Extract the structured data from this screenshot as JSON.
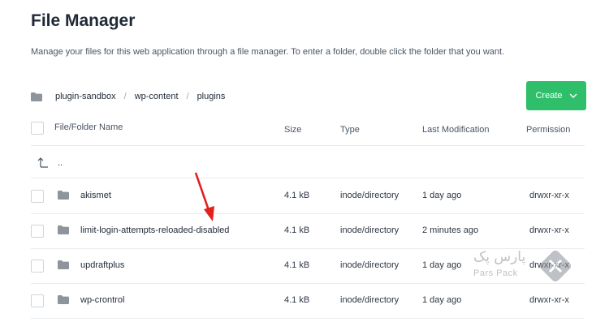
{
  "page": {
    "title": "File Manager",
    "description": "Manage your files for this web application through a file manager. To enter a folder, double click the folder that you want."
  },
  "breadcrumb": {
    "items": [
      "plugin-sandbox",
      "wp-content",
      "plugins"
    ],
    "separator": "/"
  },
  "create_button": {
    "label": "Create",
    "icon": "chevron-down-icon",
    "color": "#2fbf6a"
  },
  "table": {
    "headers": {
      "name": "File/Folder Name",
      "size": "Size",
      "type": "Type",
      "modified": "Last Modification",
      "permission": "Permission"
    },
    "parent_row": {
      "label": "..",
      "icon": "level-up-icon"
    },
    "rows": [
      {
        "name": "akismet",
        "size": "4.1 kB",
        "type": "inode/directory",
        "modified": "1 day ago",
        "permission": "drwxr-xr-x"
      },
      {
        "name": "limit-login-attempts-reloaded-disabled",
        "size": "4.1 kB",
        "type": "inode/directory",
        "modified": "2 minutes ago",
        "permission": "drwxr-xr-x"
      },
      {
        "name": "updraftplus",
        "size": "4.1 kB",
        "type": "inode/directory",
        "modified": "1 day ago",
        "permission": "drwxr-xr-x"
      },
      {
        "name": "wp-crontrol",
        "size": "4.1 kB",
        "type": "inode/directory",
        "modified": "1 day ago",
        "permission": "drwxr-xr-x"
      }
    ]
  },
  "watermark": {
    "line1": "پارس پک",
    "line2": "Pars Pack"
  },
  "annotation": {
    "color": "#e0211c"
  }
}
